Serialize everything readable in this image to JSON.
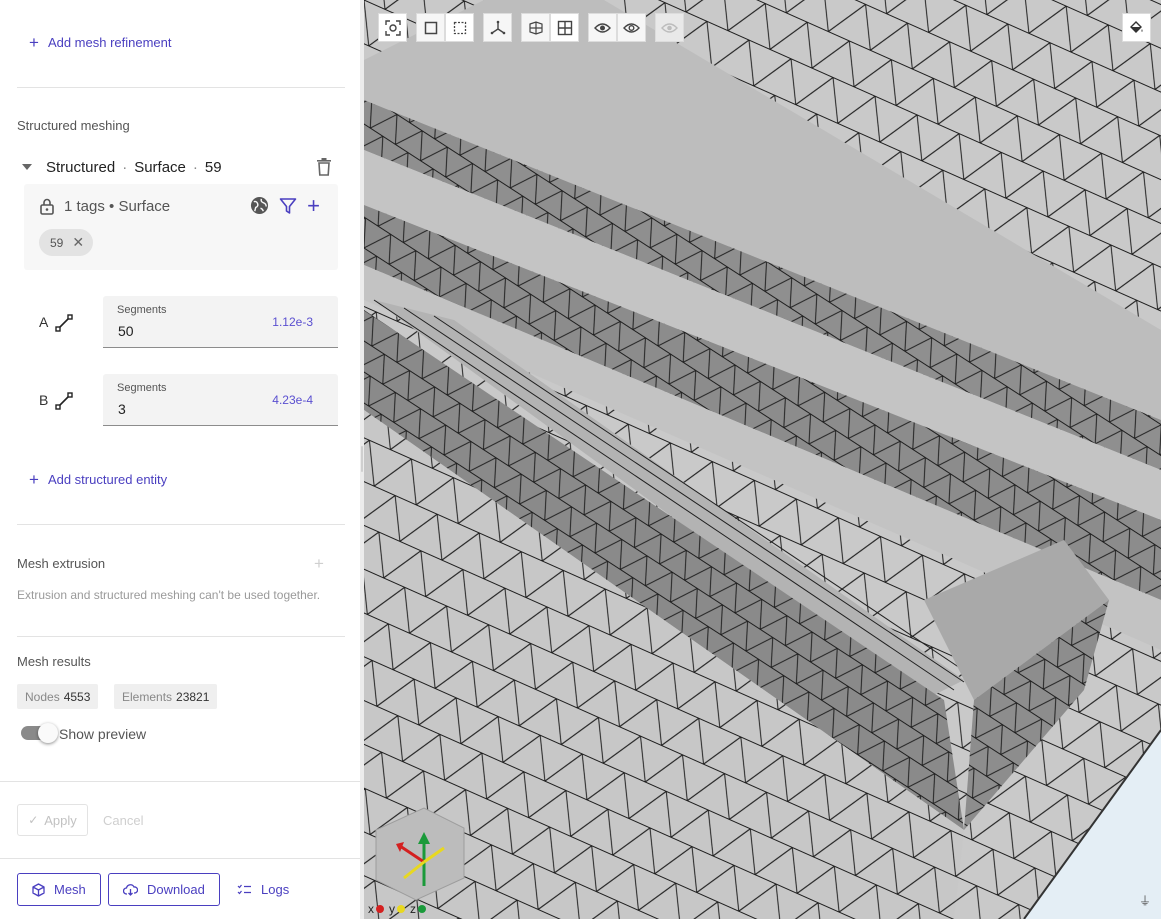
{
  "sidebar": {
    "add_refinement_label": "Add mesh refinement",
    "structured_title": "Structured meshing",
    "structured_entity": {
      "kind": "Structured",
      "type": "Surface",
      "id": "59",
      "tag_summary": "1 tags • Surface",
      "chip": "59",
      "edges": [
        {
          "label": "A",
          "field_label": "Segments",
          "value": "50",
          "size": "1.12e-3"
        },
        {
          "label": "B",
          "field_label": "Segments",
          "value": "3",
          "size": "4.23e-4"
        }
      ]
    },
    "add_structured_label": "Add structured entity",
    "extrusion_title": "Mesh extrusion",
    "extrusion_note": "Extrusion and structured meshing can't be used together.",
    "results_title": "Mesh results",
    "nodes_label": "Nodes",
    "nodes_value": "4553",
    "elements_label": "Elements",
    "elements_value": "23821",
    "show_preview_label": "Show preview",
    "apply_label": "Apply",
    "cancel_label": "Cancel",
    "mesh_label": "Mesh",
    "download_label": "Download",
    "logs_label": "Logs"
  },
  "viewport": {
    "axes": {
      "x": "x",
      "y": "y",
      "z": "z"
    },
    "toolbar_icons": [
      "focus-icon",
      "solid-box-icon",
      "box-select-icon",
      "axes-icon",
      "section-icon",
      "grid-icon",
      "eye-icon",
      "eye-outline-icon",
      "eye-disabled-icon"
    ],
    "axis_colors": {
      "x": "#d42020",
      "y": "#e8d820",
      "z": "#1a9a3a"
    }
  },
  "colors": {
    "accent": "#4a3fc0",
    "mesh_face": "#c6c6c6",
    "mesh_dark": "#8e8e8e",
    "edge": "#1e1e1e"
  }
}
